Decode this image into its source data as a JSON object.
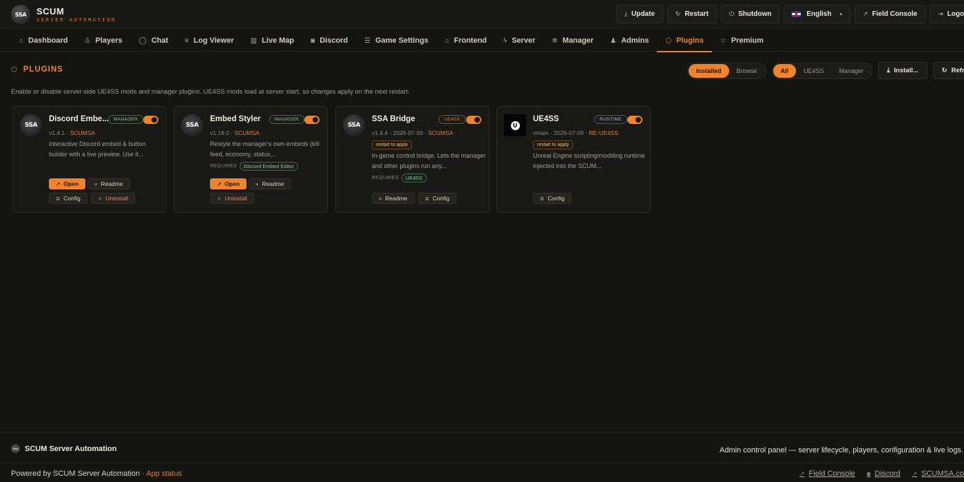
{
  "brand": {
    "logo_text": "SSA",
    "title": "SCUM",
    "subtitle": "SERVER AUTOMATION"
  },
  "header_actions": [
    {
      "icon": "download-icon",
      "glyph": "⤓",
      "label": "Update"
    },
    {
      "icon": "restart-icon",
      "glyph": "↻",
      "label": "Restart"
    },
    {
      "icon": "power-icon",
      "glyph": "⏻",
      "label": "Shutdown"
    },
    {
      "icon": "uk-flag-icon",
      "glyph": "",
      "label": "English",
      "caret": "▾"
    },
    {
      "icon": "external-link-icon",
      "glyph": "↗",
      "label": "Field Console"
    },
    {
      "icon": "logout-icon",
      "glyph": "⇥",
      "label": "Logout"
    }
  ],
  "nav": [
    {
      "icon": "home-icon",
      "glyph": "⌂",
      "label": "Dashboard"
    },
    {
      "icon": "user-icon",
      "glyph": "♙",
      "label": "Players"
    },
    {
      "icon": "chat-icon",
      "glyph": "◯",
      "label": "Chat"
    },
    {
      "icon": "list-icon",
      "glyph": "≡",
      "label": "Log Viewer"
    },
    {
      "icon": "map-icon",
      "glyph": "▥",
      "label": "Live Map"
    },
    {
      "icon": "discord-icon",
      "glyph": "◙",
      "label": "Discord"
    },
    {
      "icon": "sliders-icon",
      "glyph": "☰",
      "label": "Game Settings"
    },
    {
      "icon": "frontend-icon",
      "glyph": "⌂",
      "label": "Frontend"
    },
    {
      "icon": "bolt-icon",
      "glyph": "ϟ",
      "label": "Server"
    },
    {
      "icon": "gear-icon",
      "glyph": "✲",
      "label": "Manager"
    },
    {
      "icon": "admins-icon",
      "glyph": "♟",
      "label": "Admins"
    },
    {
      "icon": "plugin-icon",
      "glyph": "⬡",
      "label": "Plugins",
      "active": true
    },
    {
      "icon": "star-icon",
      "glyph": "☆",
      "label": "Premium"
    }
  ],
  "plugins": {
    "title": "PLUGINS",
    "description": "Enable or disable server-side UE4SS mods and manager plugins. UE4SS mods load at server start, so changes apply on the next restart.",
    "view_filter": {
      "options": [
        "Installed",
        "Browse"
      ],
      "selected": "Installed"
    },
    "type_filter": {
      "options": [
        "All",
        "UE4SS",
        "Manager"
      ],
      "selected": "All"
    },
    "install_label": "Install...",
    "refresh_label": "Refresh",
    "cards": [
      {
        "name": "Discord Embe...",
        "badge": "MANAGER",
        "logo": "SSA",
        "version": "v1.4.1",
        "date": "",
        "author": "SCUMSA",
        "restart_chip": "",
        "description": "Interactive Discord embed & button builder with a live preview. Use it...",
        "requires_label": "",
        "requires": "",
        "enabled": true,
        "buttons": [
          "Open",
          "Readme",
          "Config",
          "Uninstall"
        ]
      },
      {
        "name": "Embed Styler",
        "badge": "MANAGER",
        "logo": "SSA",
        "version": "v1.16.0",
        "date": "",
        "author": "SCUMSA",
        "restart_chip": "",
        "description": "Restyle the manager's own embeds (kill feed, economy, status,...",
        "requires_label": "REQUIRES",
        "requires": "Discord Embed Editor",
        "enabled": true,
        "buttons": [
          "Open",
          "Readme",
          "Uninstall"
        ]
      },
      {
        "name": "SSA Bridge",
        "badge": "UE4SS",
        "logo": "SSA",
        "version": "v1.4.4",
        "date": "2026-07-09",
        "author": "SCUMSA",
        "restart_chip": "restart to apply",
        "description": "In-game control bridge. Lets the manager and other plugins run any...",
        "requires_label": "REQUIRES",
        "requires": "UE4SS",
        "enabled": true,
        "buttons": [
          "Readme",
          "Config"
        ]
      },
      {
        "name": "UE4SS",
        "badge": "RUNTIME",
        "logo": "U",
        "version": "vmain",
        "date": "2026-07-09",
        "author": "RE-UE4SS",
        "restart_chip": "restart to apply",
        "description": "Unreal Engine scripting/modding runtime injected into the SCUM...",
        "requires_label": "",
        "requires": "",
        "enabled": true,
        "buttons": [
          "Config"
        ]
      }
    ]
  },
  "footer": {
    "brand": "SCUM Server Automation",
    "mini_logo": "SSA",
    "tagline": "Admin control panel — server lifecycle, players, configuration & live logs.",
    "powered_prefix": "Powered by SCUM Server Automation · ",
    "app_status": "App status",
    "links": [
      "Field Console",
      "Discord",
      "SCUMSA.com"
    ]
  },
  "colors": {
    "accent": "#f0842a",
    "background": "#141410",
    "manager_badge": "#8ec69a",
    "runtime_badge": "#9db4d6"
  }
}
